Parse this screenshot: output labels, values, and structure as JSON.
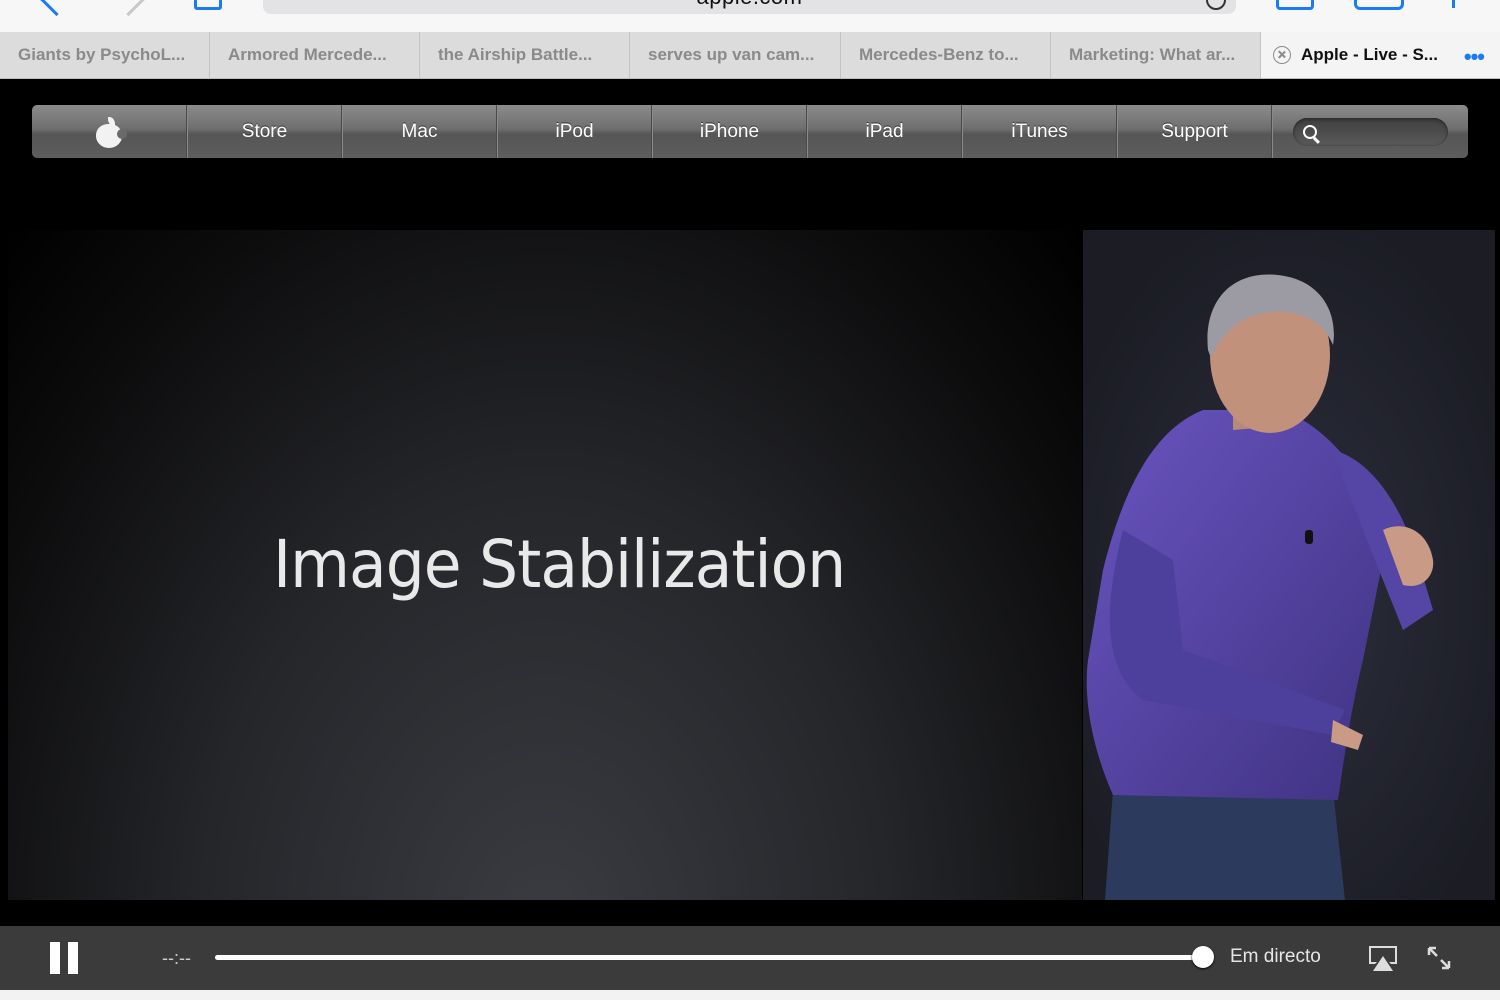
{
  "toolbar": {
    "url": "apple.com"
  },
  "tabs": [
    {
      "label": "Giants by PsychoL...",
      "active": false
    },
    {
      "label": "Armored Mercede...",
      "active": false
    },
    {
      "label": "the Airship Battle...",
      "active": false
    },
    {
      "label": "serves up van cam...",
      "active": false
    },
    {
      "label": "Mercedes-Benz to...",
      "active": false
    },
    {
      "label": "Marketing: What ar...",
      "active": false
    },
    {
      "label": "Apple - Live - S...",
      "active": true
    }
  ],
  "tab_more": "•••",
  "nav": {
    "items": [
      "Store",
      "Mac",
      "iPod",
      "iPhone",
      "iPad",
      "iTunes",
      "Support"
    ]
  },
  "video": {
    "slide_title": "Image Stabilization"
  },
  "player": {
    "time": "--:--",
    "progress_fraction": 1.0,
    "live_label": "Em directo"
  },
  "colors": {
    "accent": "#1a7cf5",
    "speaker_shirt": "#5a46a8"
  }
}
